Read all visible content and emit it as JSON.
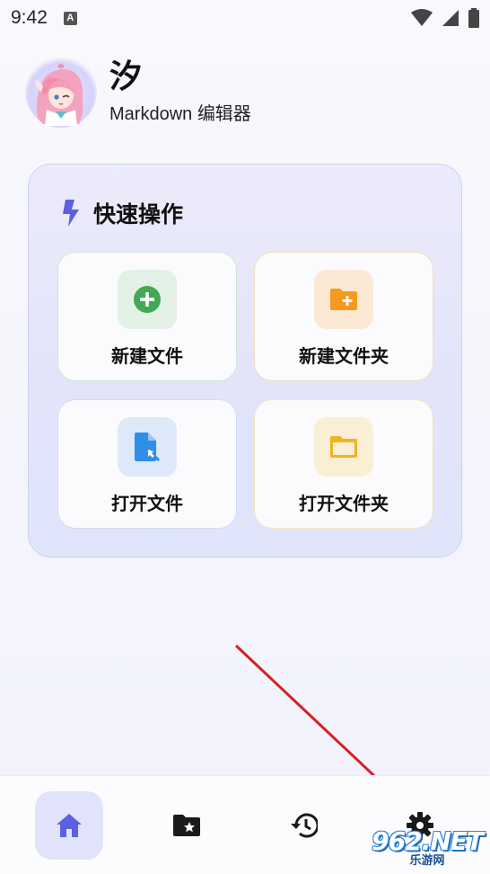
{
  "status_bar": {
    "time": "9:42",
    "notification_badge": "A"
  },
  "app": {
    "title": "汐",
    "subtitle": "Markdown 编辑器"
  },
  "quick_actions": {
    "title": "快速操作",
    "icon": "lightning-icon",
    "tiles": [
      {
        "label": "新建文件",
        "icon": "add-circle-icon",
        "color": "#4caf50",
        "bg": "#e3f1e6"
      },
      {
        "label": "新建文件夹",
        "icon": "folder-add-icon",
        "color": "#f59a1e",
        "bg": "#fbe9d5"
      },
      {
        "label": "打开文件",
        "icon": "file-open-icon",
        "color": "#2f8fe8",
        "bg": "#dde9f8"
      },
      {
        "label": "打开文件夹",
        "icon": "folder-icon",
        "color": "#f0b321",
        "bg": "#f8efd5"
      }
    ]
  },
  "bottom_nav": {
    "items": [
      {
        "name": "home",
        "icon": "home-icon",
        "active": true
      },
      {
        "name": "favorites",
        "icon": "folder-star-icon",
        "active": false
      },
      {
        "name": "history",
        "icon": "history-icon",
        "active": false
      },
      {
        "name": "settings",
        "icon": "gear-icon",
        "active": false
      }
    ]
  },
  "watermark": {
    "main": "962.NET",
    "sub": "乐游网"
  },
  "colors": {
    "accent": "#5b62e0",
    "arrow": "#d62020"
  }
}
